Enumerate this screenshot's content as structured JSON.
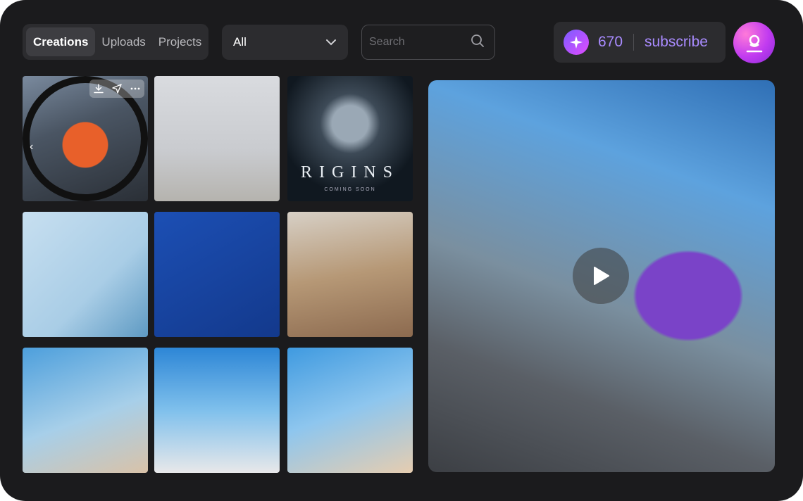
{
  "tabs": [
    {
      "label": "Creations",
      "active": true
    },
    {
      "label": "Uploads",
      "active": false
    },
    {
      "label": "Projects",
      "active": false
    }
  ],
  "filter": {
    "selected": "All"
  },
  "search": {
    "placeholder": "Search"
  },
  "credits": {
    "count": "670",
    "subscribe_label": "subscribe"
  },
  "gallery": {
    "poster_title": "RIGINS",
    "poster_subtitle": "COMING SOON"
  },
  "colors": {
    "accent": "#a98bff",
    "background": "#1b1b1d",
    "panel": "#2c2c2f"
  },
  "icons": [
    "chevron-down-icon",
    "search-icon",
    "sparkle-icon",
    "user-avatar-icon",
    "download-icon",
    "share-icon",
    "more-icon",
    "chevron-left-icon",
    "play-icon"
  ]
}
